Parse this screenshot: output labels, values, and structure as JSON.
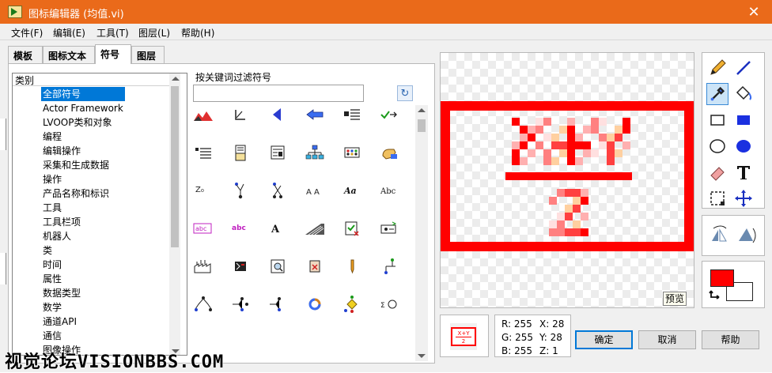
{
  "window": {
    "title": "图标编辑器 (均值.vi)",
    "close_glyph": "✕"
  },
  "menu": [
    {
      "label": "文件(F)"
    },
    {
      "label": "编辑(E)"
    },
    {
      "label": "工具(T)"
    },
    {
      "label": "图层(L)"
    },
    {
      "label": "帮助(H)"
    }
  ],
  "tabs": [
    {
      "label": "模板"
    },
    {
      "label": "图标文本"
    },
    {
      "label": "符号",
      "active": true
    },
    {
      "label": "图层"
    }
  ],
  "categories": {
    "header": "类别",
    "items": [
      {
        "label": "全部符号",
        "selected": true
      },
      {
        "label": "Actor Framework"
      },
      {
        "label": "LVOOP类和对象"
      },
      {
        "label": "编程"
      },
      {
        "label": "编辑操作"
      },
      {
        "label": "采集和生成数据"
      },
      {
        "label": "操作"
      },
      {
        "label": "产品名称和标识"
      },
      {
        "label": "工具"
      },
      {
        "label": "工具栏项"
      },
      {
        "label": "机器人"
      },
      {
        "label": "类"
      },
      {
        "label": "时间"
      },
      {
        "label": "属性"
      },
      {
        "label": "数据类型"
      },
      {
        "label": "数学"
      },
      {
        "label": "通道API"
      },
      {
        "label": "通信"
      },
      {
        "label": "图像操作"
      }
    ]
  },
  "filter": {
    "label": "按关键词过滤符号",
    "value": "",
    "refresh_glyph": "↻"
  },
  "glyph_labels": {
    "aa": "Aa",
    "abc": "Abc",
    "abc_pink": "abc",
    "abc_pink2": "abc",
    "a_serif": "A",
    "sigma": "Σ",
    "z0": "Z₀",
    "a_a": "A A"
  },
  "symbols": [
    {
      "icon": "mountain-red-icon"
    },
    {
      "icon": "axis-icon"
    },
    {
      "icon": "blue-triangle-left-icon"
    },
    {
      "icon": "blue-arrow-left-icon"
    },
    {
      "icon": "list-icon"
    },
    {
      "icon": "green-arrow-icon"
    },
    {
      "icon": "table-icon"
    },
    {
      "icon": "document-icon"
    },
    {
      "icon": "form-icon"
    },
    {
      "icon": "network-icon"
    },
    {
      "icon": "dots-grid-icon"
    },
    {
      "icon": "hand-icon"
    },
    {
      "icon": "z0-icon"
    },
    {
      "icon": "tree-icon"
    },
    {
      "icon": "tree2-icon"
    },
    {
      "icon": "a-a-icon"
    },
    {
      "icon": "aa-icon"
    },
    {
      "icon": "abc-icon"
    },
    {
      "icon": "abc-pink-icon"
    },
    {
      "icon": "abc-pink2-icon"
    },
    {
      "icon": "serif-a-icon"
    },
    {
      "icon": "ramp-icon"
    },
    {
      "icon": "check-doc-icon"
    },
    {
      "icon": "io-icon"
    },
    {
      "icon": "factory-icon"
    },
    {
      "icon": "chip-icon"
    },
    {
      "icon": "magnify-icon"
    },
    {
      "icon": "cross-doc-icon"
    },
    {
      "icon": "pencil-small-icon"
    },
    {
      "icon": "flow-icon"
    },
    {
      "icon": "tree3-icon"
    },
    {
      "icon": "tree4-icon"
    },
    {
      "icon": "tree5-icon"
    },
    {
      "icon": "cycle-icon"
    },
    {
      "icon": "yellow-diamond-icon"
    },
    {
      "icon": "sigma-icon"
    }
  ],
  "preview": {
    "numerator": "X+Y",
    "denominator": "2",
    "preview_label": "预览",
    "frame_color": "#ff0000"
  },
  "colors": {
    "foreground": "#ff0000",
    "background": "#ffffff"
  },
  "info": {
    "r": "R: 255",
    "g": "G: 255",
    "b": "B: 255",
    "x": "X: 28",
    "y": "Y: 28",
    "z": "Z: 1"
  },
  "buttons": {
    "ok": "确定",
    "cancel": "取消",
    "help": "帮助"
  },
  "watermark": "视觉论坛VISIONBBS.COM"
}
